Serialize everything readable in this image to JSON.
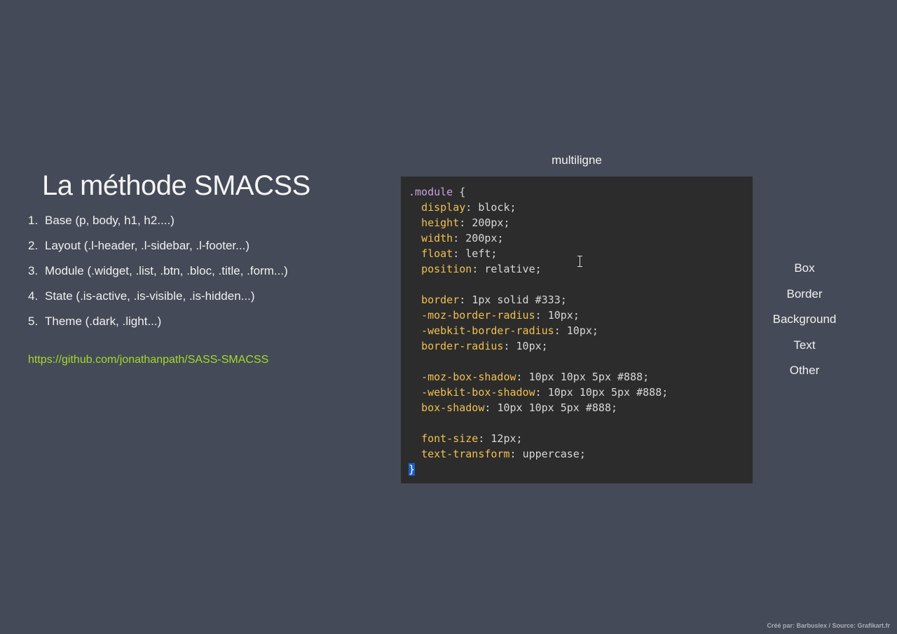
{
  "slide": {
    "title": "La méthode SMACSS",
    "list": [
      {
        "num": "1.",
        "text": "Base (p, body, h1, h2....)"
      },
      {
        "num": "2.",
        "text": "Layout (.l-header, .l-sidebar, .l-footer...)"
      },
      {
        "num": "3.",
        "text": "Module (.widget, .list, .btn, .bloc, .title, .form...)"
      },
      {
        "num": "4.",
        "text": "State (.is-active, .is-visible, .is-hidden...)"
      },
      {
        "num": "5.",
        "text": "Theme (.dark, .light...)"
      }
    ],
    "link": "https://github.com/jonathanpath/SASS-SMACSS"
  },
  "code": {
    "caption": "multiligne",
    "selector": ".module",
    "open_brace": "{",
    "close_brace": "}",
    "lines": [
      {
        "prop": "display",
        "value": "block"
      },
      {
        "prop": "height",
        "value": "200px"
      },
      {
        "prop": "width",
        "value": "200px"
      },
      {
        "prop": "float",
        "value": "left"
      },
      {
        "prop": "position",
        "value": "relative"
      },
      {
        "prop": "border",
        "value": "1px solid #333"
      },
      {
        "prop": "-moz-border-radius",
        "value": "10px"
      },
      {
        "prop": "-webkit-border-radius",
        "value": "10px"
      },
      {
        "prop": "border-radius",
        "value": "10px"
      },
      {
        "prop": "-moz-box-shadow",
        "value": "10px 10px 5px #888"
      },
      {
        "prop": "-webkit-box-shadow",
        "value": "10px 10px 5px #888"
      },
      {
        "prop": "box-shadow",
        "value": "10px 10px 5px #888"
      },
      {
        "prop": "font-size",
        "value": "12px"
      },
      {
        "prop": "text-transform",
        "value": "uppercase"
      }
    ]
  },
  "categories": [
    "Box",
    "Border",
    "Background",
    "Text",
    "Other"
  ],
  "credit": "Créé par: Barbuslex / Source: Grafikart.fr",
  "colors": {
    "background": "#444a57",
    "code_background": "#2c2c2c",
    "property": "#f0c050",
    "selector": "#c8a0e0",
    "link": "#a8d82a",
    "selection": "#1a5fc8"
  }
}
